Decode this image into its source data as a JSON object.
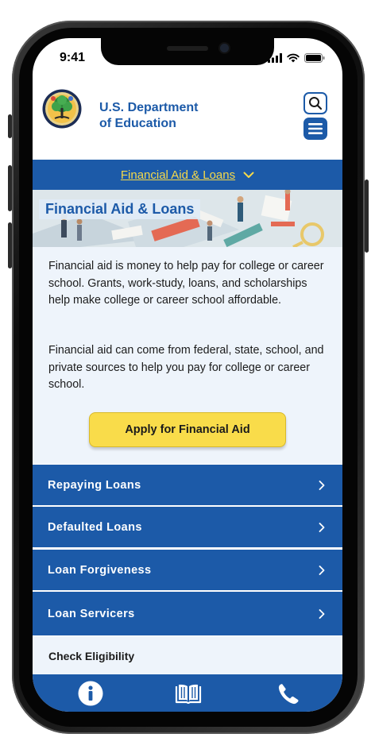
{
  "status_bar": {
    "time": "9:41"
  },
  "header": {
    "org_line1": "U.S. Department",
    "org_line2": "of Education"
  },
  "subnav": {
    "label": "Financial Aid & Loans"
  },
  "banner": {
    "title": "Financial Aid & Loans"
  },
  "intro": {
    "paragraph1": "Financial aid is money to help pay for college or career school. Grants, work-study, loans, and scholarships help make college or career school affordable.",
    "paragraph2": "Financial aid can come from federal, state, school, and private sources to help you pay for college or career school.",
    "apply_button": "Apply for Financial Aid"
  },
  "nav_items": [
    {
      "label": "Repaying Loans",
      "chevron": "›"
    },
    {
      "label": "Defaulted Loans",
      "chevron": "›"
    },
    {
      "label": "Loan Forgiveness",
      "chevron": "›"
    },
    {
      "label": "Loan Servicers",
      "chevron": "›"
    }
  ],
  "check_eligibility": {
    "label": "Check Eligibility"
  },
  "tab_bar": {
    "icons": [
      "info-icon",
      "book-icon",
      "phone-icon"
    ]
  },
  "colors": {
    "brand_blue": "#1c5aa8",
    "accent_yellow": "#f9dc4a",
    "light_bg": "#eef4fb"
  }
}
